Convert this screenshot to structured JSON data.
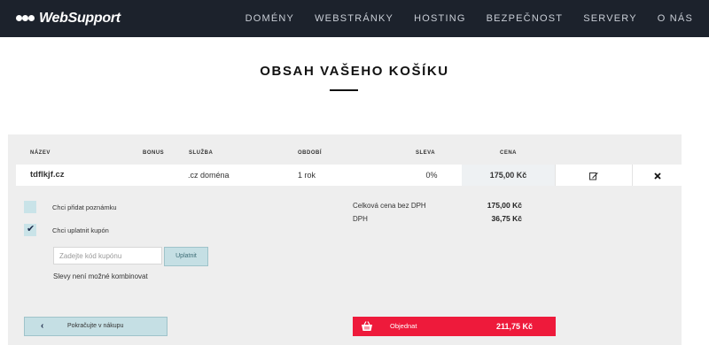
{
  "brand": {
    "name": "WebSupport"
  },
  "nav": [
    "DOMÉNY",
    "WEBSTRÁNKY",
    "HOSTING",
    "BEZPEČNOST",
    "SERVERY",
    "O NÁS"
  ],
  "page": {
    "title": "OBSAH VAŠEHO KOŠÍKU"
  },
  "table": {
    "headers": {
      "name": "NÁZEV",
      "bonus": "BONUS",
      "service": "SLUŽBA",
      "period": "OBDOBÍ",
      "discount": "SLEVA",
      "price": "CENA"
    },
    "rows": [
      {
        "name": "tdflkjf.cz",
        "service": ".cz doména",
        "period": "1 rok",
        "discount": "0%",
        "price": "175,00 Kč",
        "edit_icon": "edit-icon",
        "remove_icon": "close-icon"
      }
    ]
  },
  "options": {
    "note_label": "Chci přidat poznámku",
    "note_checked": false,
    "coupon_label": "Chci uplatnit kupón",
    "coupon_checked": true,
    "coupon_placeholder": "Zadejte kód kupónu",
    "coupon_button": "Uplatnit",
    "combine_note": "Slevy není možné kombinovat"
  },
  "summary": {
    "without_vat_label": "Celková cena bez DPH",
    "without_vat_value": "175,00 Kč",
    "vat_label": "DPH",
    "vat_value": "36,75 Kč"
  },
  "actions": {
    "back_label": "Pokračujte v nákupu",
    "order_label": "Objednat",
    "order_total": "211,75 Kč"
  },
  "colors": {
    "nav_bg": "#1c222c",
    "accent_red": "#ee1a3b",
    "light_teal": "#c5dfe4"
  }
}
